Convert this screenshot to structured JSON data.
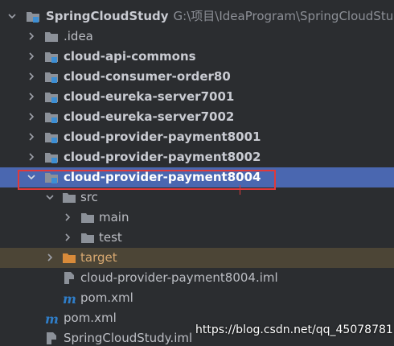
{
  "tree": {
    "root": {
      "name": "SpringCloudStudy",
      "path": "G:\\项目\\IdeaProgram\\SpringCloudStud"
    },
    "modules": [
      {
        "name": ".idea"
      },
      {
        "name": "cloud-api-commons"
      },
      {
        "name": "cloud-consumer-order80"
      },
      {
        "name": "cloud-eureka-server7001"
      },
      {
        "name": "cloud-eureka-server7002"
      },
      {
        "name": "cloud-provider-payment8001"
      },
      {
        "name": "cloud-provider-payment8002"
      },
      {
        "name": "cloud-provider-payment8004"
      }
    ],
    "src": {
      "name": "src",
      "main": "main",
      "test": "test"
    },
    "target": "target",
    "module_iml": "cloud-provider-payment8004.iml",
    "module_pom": "pom.xml",
    "root_pom": "pom.xml",
    "root_iml": "SpringCloudStudy.iml"
  },
  "watermark": "https://blog.csdn.net/qq_45078781",
  "colors": {
    "background": "#2b2d30",
    "selection": "#4a67b0",
    "excluded": "#4c4536",
    "highlight_box": "#e0393a",
    "folder": "#8c9199",
    "module_badge": "#3d8fd4",
    "maven": "#2f7ec9"
  }
}
